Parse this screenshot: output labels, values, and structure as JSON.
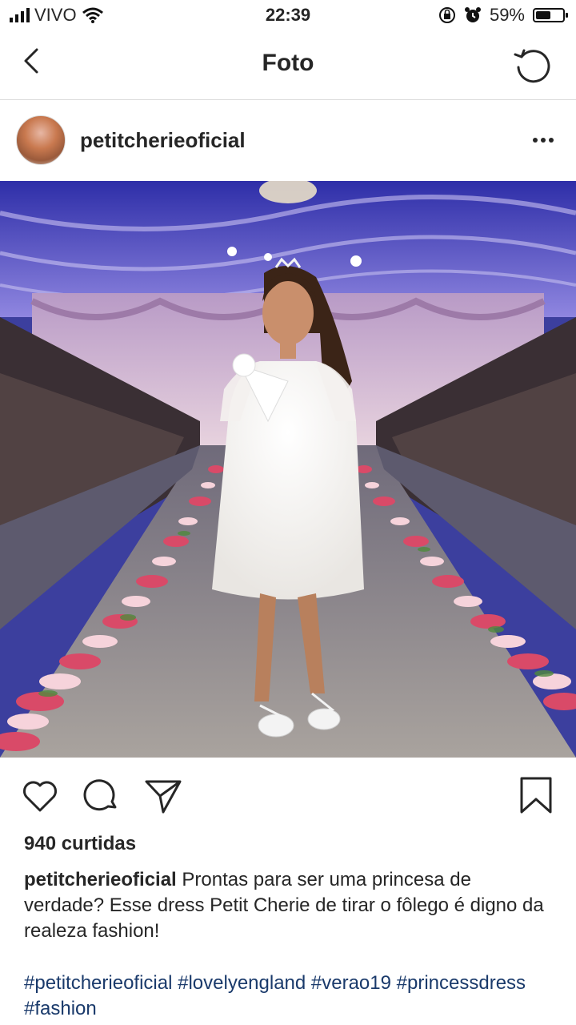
{
  "status_bar": {
    "carrier": "VIVO",
    "time": "22:39",
    "battery_percent": "59%",
    "battery_level": 0.59
  },
  "nav": {
    "title": "Foto",
    "back_icon": "chevron-left-icon",
    "refresh_icon": "refresh-icon"
  },
  "post": {
    "username": "petitcherieoficial",
    "likes": "940 curtidas",
    "caption_user": "petitcherieoficial",
    "caption_text": "Prontas para ser uma princesa de verdade? Esse dress Petit Cherie de tirar o fôlego é digno da realeza fashion!",
    "hashtags": "#petitcherieoficial #lovelyengland #verao19 #princessdress #fashion"
  },
  "icons": {
    "like": "heart-icon",
    "comment": "comment-icon",
    "share": "send-icon",
    "save": "bookmark-icon",
    "more": "more-icon"
  },
  "colors": {
    "hashtag": "#1a3a6b",
    "text": "#262626",
    "divider": "#dbdbdb"
  }
}
